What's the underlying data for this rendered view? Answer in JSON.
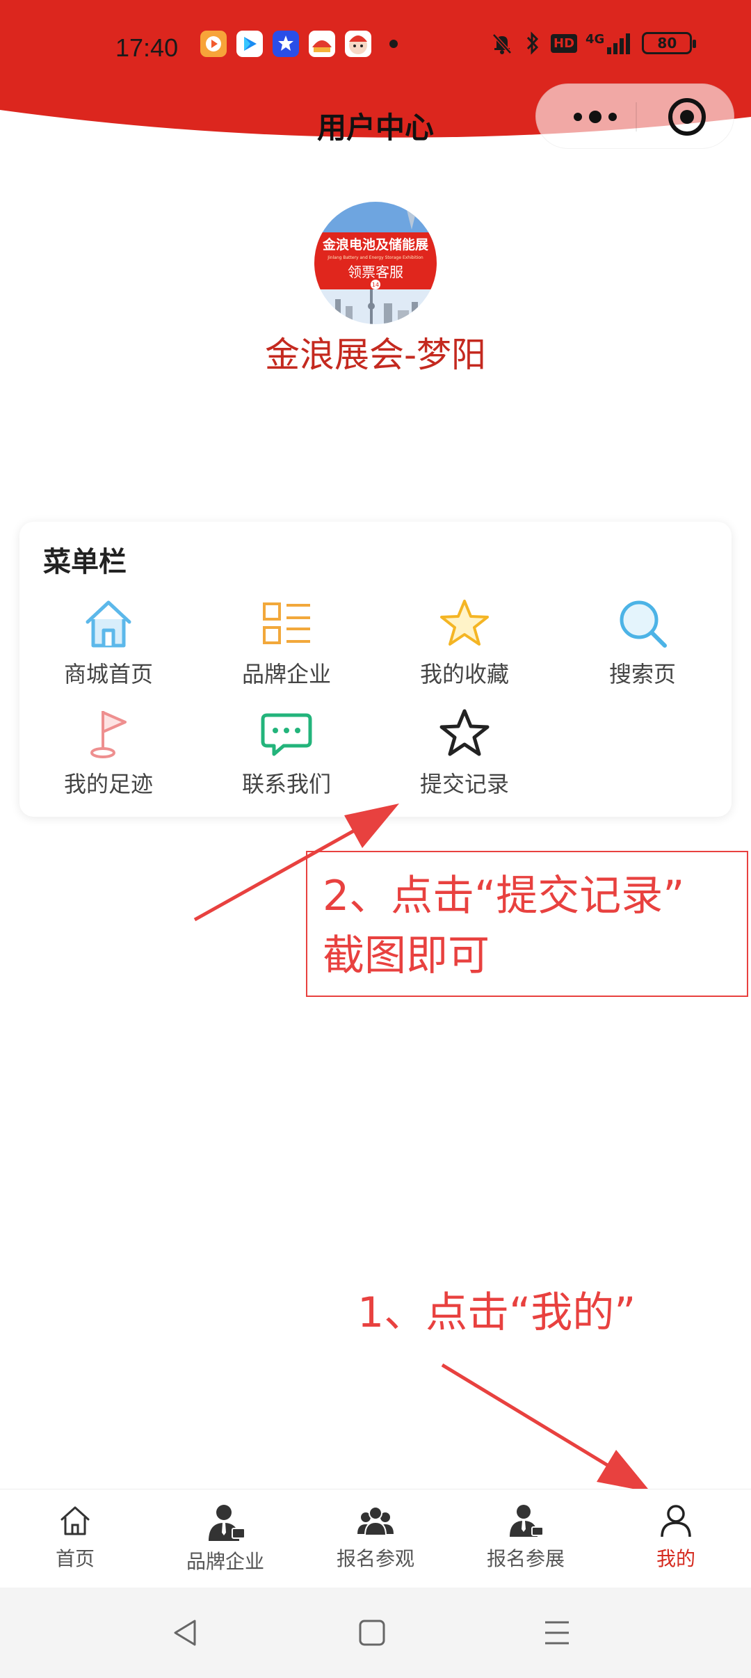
{
  "status_bar": {
    "time": "17:40",
    "network": "4G",
    "hd_badge": "HD",
    "battery": "80",
    "app_icons": [
      "video-app-icon",
      "play-app-icon",
      "gallery-app-icon",
      "bank-app-icon",
      "cartoon-app-icon"
    ]
  },
  "header": {
    "title": "用户中心",
    "bg_color": "#dc261e",
    "capsule_icons": [
      "more-icon",
      "target-icon"
    ]
  },
  "profile": {
    "avatar_banner_line1": "金浪电池及储能展",
    "avatar_banner_line2": "领票客服",
    "avatar_banner_subtitle": "Jinlang Battery and Energy Storage Exhibition",
    "avatar_badge": "14",
    "username": "金浪展会-梦阳"
  },
  "menu": {
    "title": "菜单栏",
    "items": [
      {
        "label": "商城首页",
        "icon": "home-icon"
      },
      {
        "label": "品牌企业",
        "icon": "list-icon"
      },
      {
        "label": "我的收藏",
        "icon": "star-icon"
      },
      {
        "label": "搜索页",
        "icon": "search-icon"
      },
      {
        "label": "我的足迹",
        "icon": "flag-icon"
      },
      {
        "label": "联系我们",
        "icon": "chat-icon"
      },
      {
        "label": "提交记录",
        "icon": "star-outline-icon"
      }
    ]
  },
  "annotations": {
    "step2_line1": "2、点击“提交记录”",
    "step2_line2": "截图即可",
    "step1": "1、点击“我的”",
    "color": "#e8413f"
  },
  "tabbar": {
    "active_color": "#d52b20",
    "tabs": [
      {
        "label": "首页",
        "icon": "home-outline-icon"
      },
      {
        "label": "品牌企业",
        "icon": "businessman-icon"
      },
      {
        "label": "报名参观",
        "icon": "group-icon"
      },
      {
        "label": "报名参展",
        "icon": "exhibitor-icon"
      },
      {
        "label": "我的",
        "icon": "user-icon"
      }
    ]
  },
  "system_nav": [
    "back-icon",
    "home-square-icon",
    "menu-lines-icon"
  ]
}
